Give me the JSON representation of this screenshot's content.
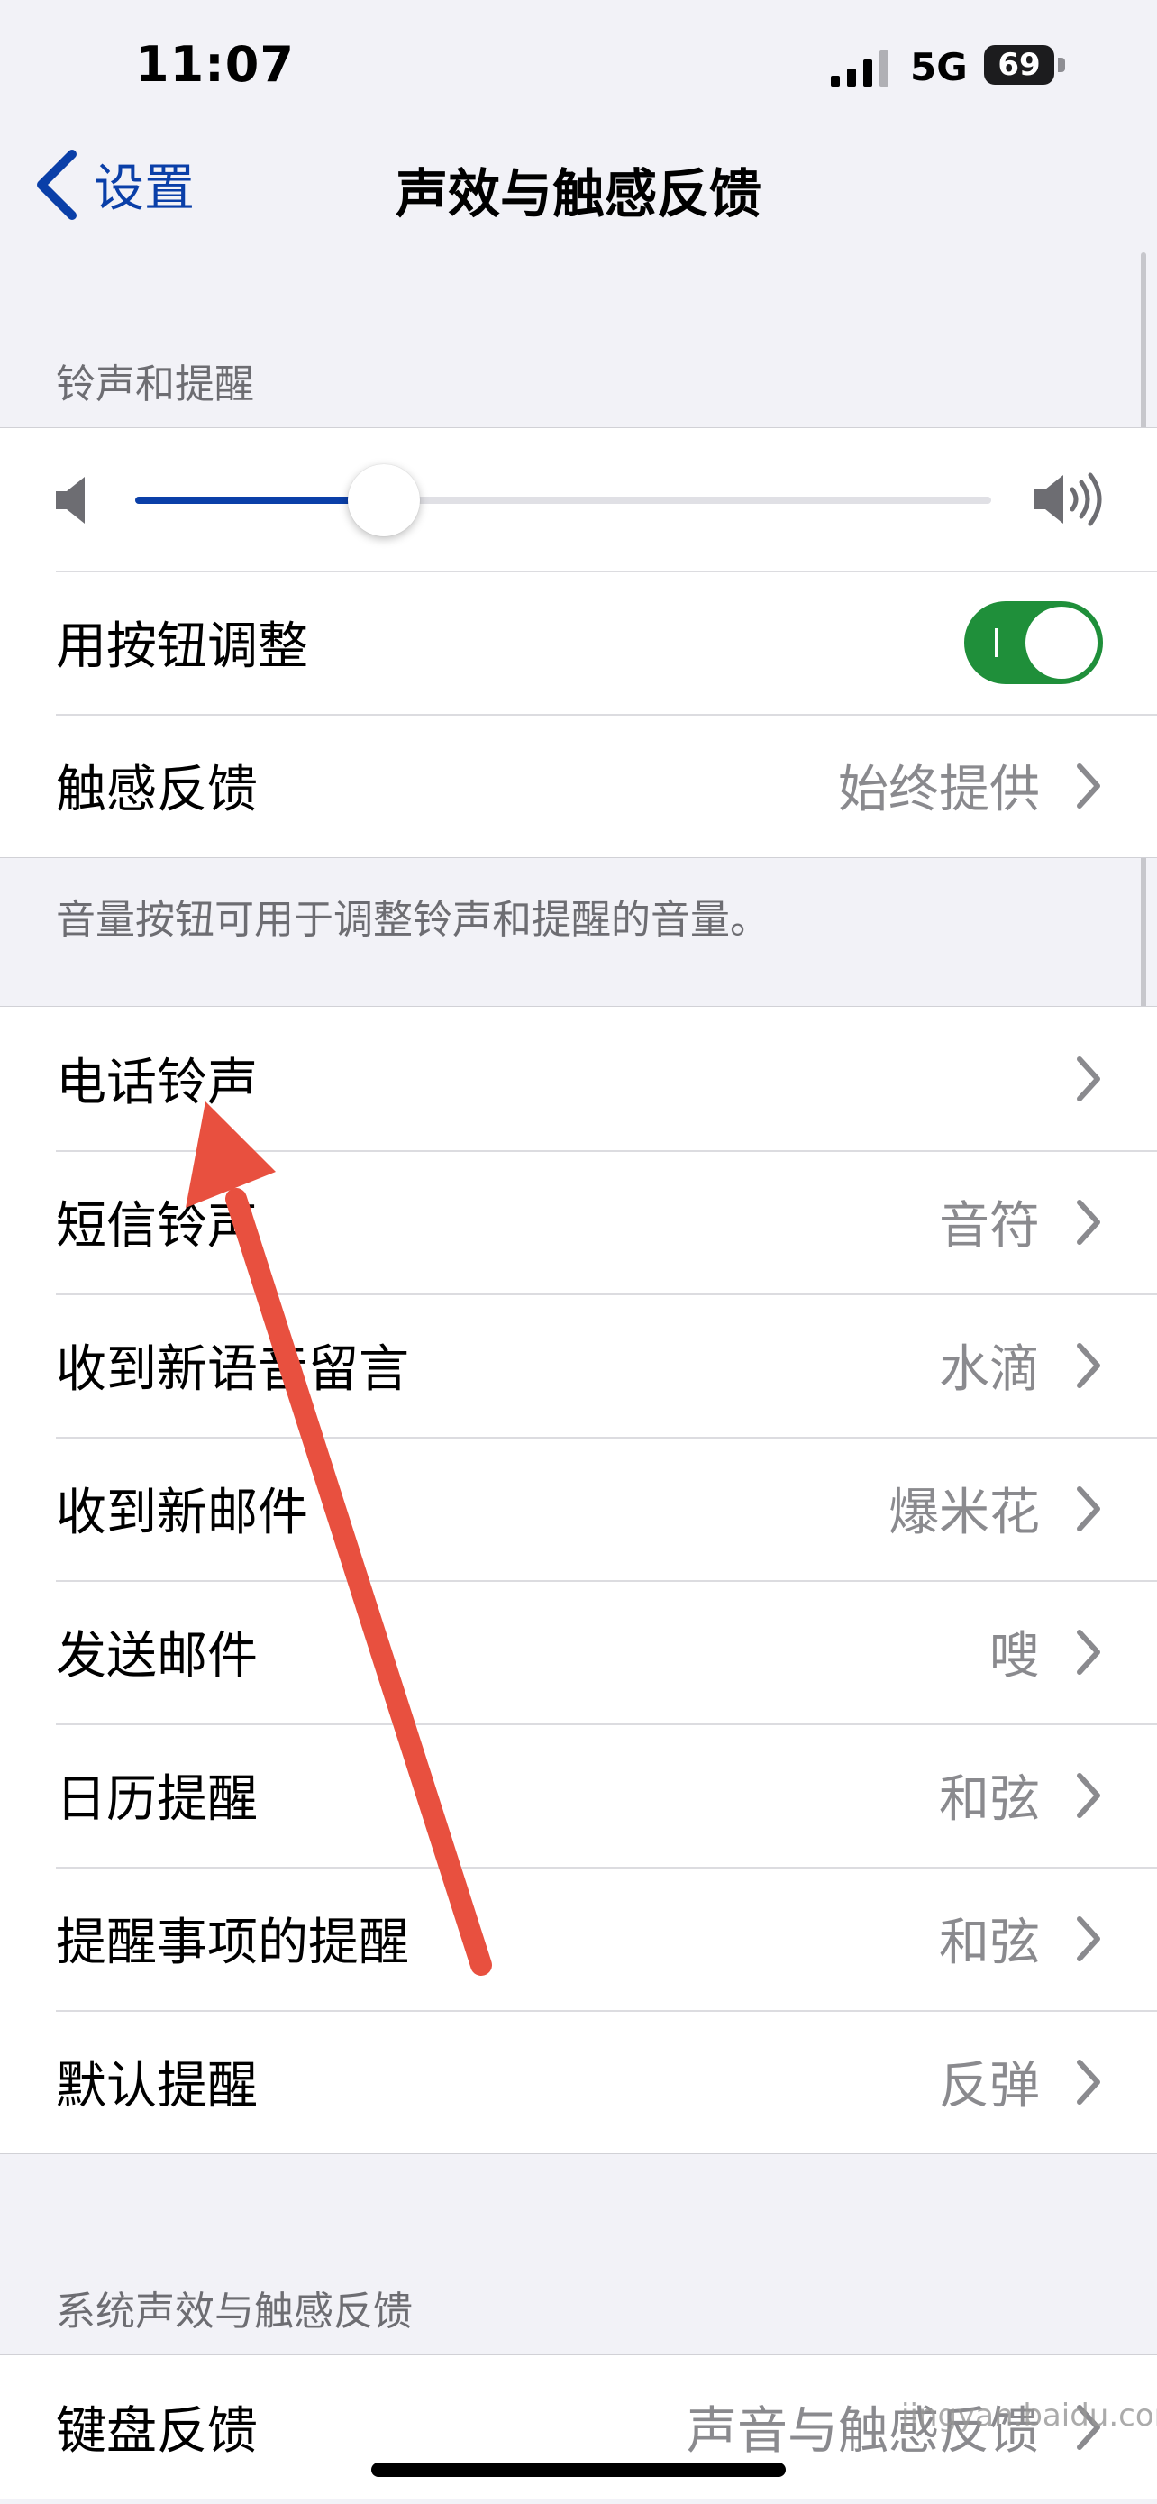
{
  "status_bar": {
    "time": "11:07",
    "network": "5G",
    "battery": "69"
  },
  "nav": {
    "back_label": "设置",
    "title": "声效与触感反馈"
  },
  "ringtones_section": {
    "header": "铃声和提醒",
    "volume_level": 0.29,
    "rows": [
      {
        "label": "用按钮调整",
        "toggle_on": true
      },
      {
        "label": "触感反馈",
        "value": "始终提供"
      }
    ],
    "footer": "音量按钮可用于调整铃声和提醒的音量。"
  },
  "sounds_section": {
    "rows": [
      {
        "label": "电话铃声",
        "value": ""
      },
      {
        "label": "短信铃声",
        "value": "音符"
      },
      {
        "label": "收到新语音留言",
        "value": "水滴"
      },
      {
        "label": "收到新邮件",
        "value": "爆米花"
      },
      {
        "label": "发送邮件",
        "value": "嗖"
      },
      {
        "label": "日历提醒",
        "value": "和弦"
      },
      {
        "label": "提醒事项的提醒",
        "value": "和弦"
      },
      {
        "label": "默认提醒",
        "value": "反弹"
      }
    ]
  },
  "system_section": {
    "header": "系统声效与触感反馈",
    "rows": [
      {
        "label": "键盘反馈",
        "value": "声音与触感反馈"
      }
    ]
  },
  "colors": {
    "accent": "#0a3fa8",
    "toggle_on": "#1f8f3a",
    "annotation_arrow": "#e8503f"
  },
  "watermark": "jingyan.baidu.com"
}
